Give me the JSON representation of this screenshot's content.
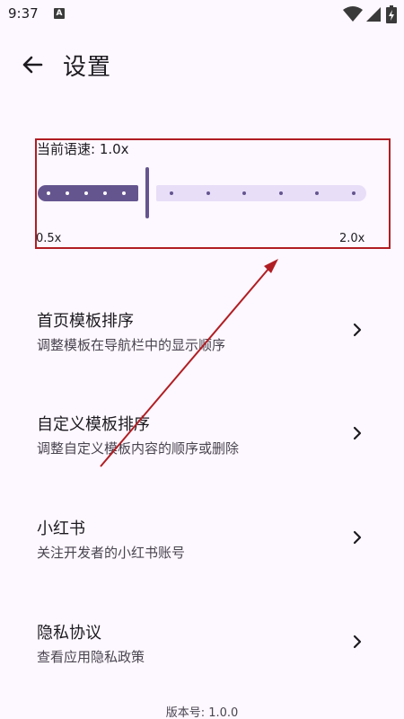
{
  "status_bar": {
    "time": "9:37",
    "notification_glyph": "A"
  },
  "header": {
    "title": "设置"
  },
  "speech_rate": {
    "label": "当前语速: 1.0x",
    "min_label": "0.5x",
    "max_label": "2.0x",
    "value": 1.0,
    "min": 0.5,
    "max": 2.0
  },
  "settings": [
    {
      "title": "首页模板排序",
      "subtitle": "调整模板在导航栏中的显示顺序"
    },
    {
      "title": "自定义模板排序",
      "subtitle": "调整自定义模板内容的顺序或删除"
    },
    {
      "title": "小红书",
      "subtitle": "关注开发者的小红书账号"
    },
    {
      "title": "隐私协议",
      "subtitle": "查看应用隐私政策"
    }
  ],
  "footer": {
    "version": "版本号: 1.0.0"
  },
  "colors": {
    "background": "#FDF7FF",
    "accent": "#65558F",
    "track_inactive": "#E8DEF8",
    "annotation_red": "#B01E23"
  },
  "icons": [
    "back-arrow-icon",
    "chevron-right-icon",
    "wifi-icon",
    "signal-icon",
    "battery-icon"
  ]
}
